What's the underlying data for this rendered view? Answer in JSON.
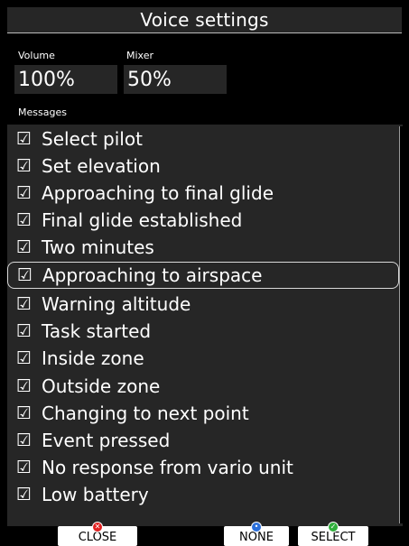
{
  "title": "Voice settings",
  "volume": {
    "label": "Volume",
    "value": "100%"
  },
  "mixer": {
    "label": "Mixer",
    "value": "50%"
  },
  "messages": {
    "label": "Messages",
    "check_glyph": "☑",
    "items": [
      {
        "label": "Select pilot",
        "checked": true
      },
      {
        "label": "Set elevation",
        "checked": true
      },
      {
        "label": "Approaching to final glide",
        "checked": true
      },
      {
        "label": "Final glide established",
        "checked": true
      },
      {
        "label": "Two minutes",
        "checked": true
      },
      {
        "label": "Approaching to airspace",
        "checked": true,
        "selected": true
      },
      {
        "label": "Warning altitude",
        "checked": true
      },
      {
        "label": "Task started",
        "checked": true
      },
      {
        "label": "Inside zone",
        "checked": true
      },
      {
        "label": "Outside zone",
        "checked": true
      },
      {
        "label": "Changing to next point",
        "checked": true
      },
      {
        "label": "Event pressed",
        "checked": true
      },
      {
        "label": "No response from vario unit",
        "checked": true
      },
      {
        "label": "Low battery",
        "checked": true
      }
    ]
  },
  "buttons": {
    "close": {
      "label": "CLOSE",
      "icon": "red-x-icon",
      "color": "#e02020"
    },
    "none": {
      "label": "NONE",
      "icon": "blue-dot-icon",
      "color": "#2a6fdb"
    },
    "select": {
      "label": "SELECT",
      "icon": "green-check-icon",
      "color": "#2fae3b"
    }
  }
}
